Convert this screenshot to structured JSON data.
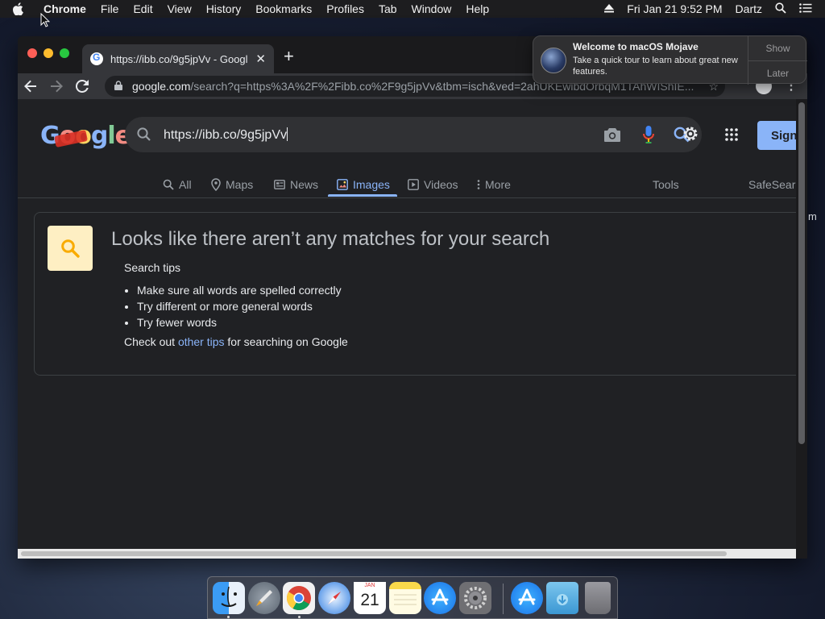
{
  "menubar": {
    "app_name": "Chrome",
    "menus": [
      "File",
      "Edit",
      "View",
      "History",
      "Bookmarks",
      "Profiles",
      "Tab",
      "Window",
      "Help"
    ],
    "datetime": "Fri Jan 21  9:52 PM",
    "user": "Dartz"
  },
  "browser": {
    "tab_title": "https://ibb.co/9g5jpVv - Googl",
    "url_host": "google.com",
    "url_path": "/search?q=https%3A%2F%2Fibb.co%2F9g5jpVv&tbm=isch&ved=2ahUKEwibdOrbqM1TAhWIShIE..."
  },
  "google": {
    "logo": "Google",
    "query": "https://ibb.co/9g5jpVv",
    "sign_in_label": "Sign",
    "tabs": [
      "All",
      "Maps",
      "News",
      "Images",
      "Videos",
      "More"
    ],
    "active_tab": "Images",
    "tools_label": "Tools",
    "safesearch_label": "SafeSearch"
  },
  "no_results": {
    "headline": "Looks like there aren’t any matches for your search",
    "tips_title": "Search tips",
    "tips": [
      "Make sure all words are spelled correctly",
      "Try different or more general words",
      "Try fewer words"
    ],
    "checkout_prefix": "Check out ",
    "checkout_link": "other tips",
    "checkout_suffix": " for searching on Google"
  },
  "notification": {
    "title": "Welcome to macOS Mojave",
    "body": "Take a quick tour to learn about great new features.",
    "show_label": "Show",
    "later_label": "Later"
  },
  "dock": {
    "apps": [
      "finder-icon",
      "launchpad-icon",
      "chrome-icon",
      "safari-icon",
      "calendar-icon",
      "notes-icon",
      "app-store-icon",
      "system-preferences-icon",
      "app-store-download-icon",
      "downloads-folder-icon",
      "trash-icon"
    ],
    "calendar_month": "JAN",
    "calendar_day": "21"
  },
  "side_text": "m",
  "colors": {
    "accent": "#8ab4f8",
    "page_bg": "#202124",
    "tile_bg": "#feefc3"
  }
}
